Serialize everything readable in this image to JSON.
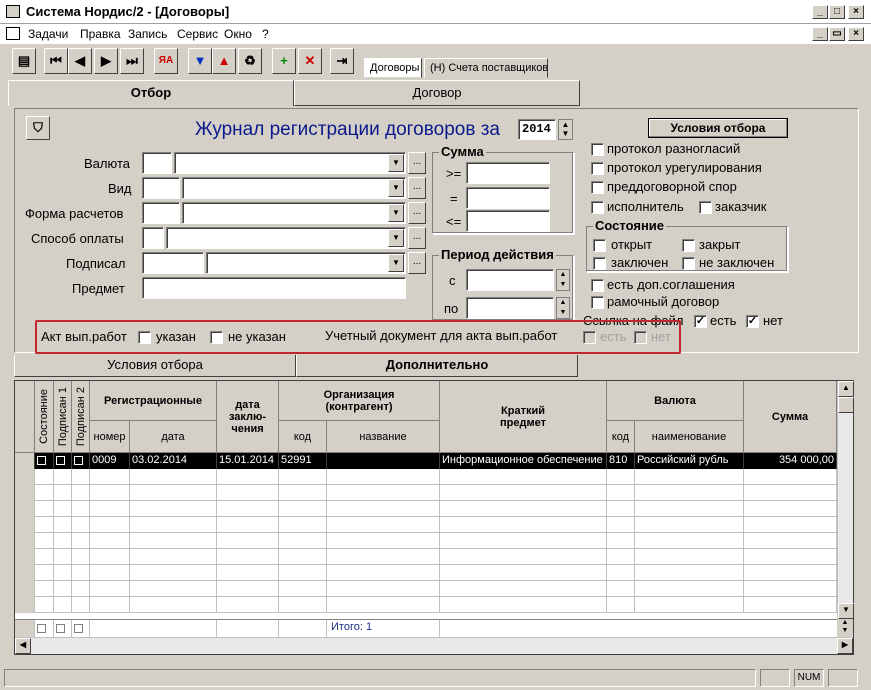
{
  "window": {
    "title": "Система Нордис/2 - [Договоры]"
  },
  "menu": [
    "Задачи",
    "Правка",
    "Запись",
    "Сервис",
    "Окно",
    "?"
  ],
  "doc_tabs": [
    "Договоры",
    "(Н) Счета поставщиков"
  ],
  "main_tabs": [
    "Отбор",
    "Договор"
  ],
  "journal": {
    "title": "Журнал регистрации договоров за",
    "year": "2014",
    "conditions_btn": "Условия отбора"
  },
  "fields": {
    "currency": "Валюта",
    "type": "Вид",
    "payment_form": "Форма расчетов",
    "payment_method": "Способ оплаты",
    "signed": "Подписал",
    "subject": "Предмет"
  },
  "sum": {
    "title": "Сумма",
    "ge": ">=",
    "eq": "=",
    "le": "<="
  },
  "period": {
    "title": "Период действия",
    "from": "с",
    "to": "по"
  },
  "checks": {
    "protocol_disagree": "протокол разногласий",
    "protocol_settle": "протокол урегулирования",
    "pre_dispute": "преддоговорной спор",
    "executor": "исполнитель",
    "customer": "заказчик"
  },
  "state": {
    "title": "Состояние",
    "open": "открыт",
    "closed": "закрыт",
    "concluded": "заключен",
    "not_concluded": "не заключен"
  },
  "extra": {
    "addendum": "есть доп.соглашения",
    "framework": "рамочный договор",
    "file_link": "Ссылка на файл",
    "yes": "есть",
    "no": "нет"
  },
  "act": {
    "label": "Акт вып.работ",
    "specified": "указан",
    "not_specified": "не указан",
    "acc_doc": "Учетный документ для акта вып.работ",
    "yes": "есть",
    "no": "нет"
  },
  "sub_tabs": [
    "Условия отбора",
    "Дополнительно"
  ],
  "grid": {
    "h_state": "Состояние",
    "h_sig1": "Подписан 1",
    "h_sig2": "Подписан 2",
    "h_reg": "Регистрационные",
    "h_num": "номер",
    "h_date": "дата",
    "h_conc": "дата заклю-чения",
    "h_org": "Организация (контрагент)",
    "h_code": "код",
    "h_name": "название",
    "h_subj": "Краткий предмет",
    "h_cur": "Валюта",
    "h_ccode": "код",
    "h_cname": "наименование",
    "h_sum": "Сумма",
    "row": {
      "num": "0009",
      "date": "03.02.2014",
      "conc": "15.01.2014",
      "code": "52991",
      "name": "",
      "subj": "Информационное обеспечение",
      "ccode": "810",
      "cname": "Российский рубль",
      "sum": "354 000,00"
    },
    "total": "Итого:  1"
  },
  "status": {
    "num": "NUM"
  }
}
